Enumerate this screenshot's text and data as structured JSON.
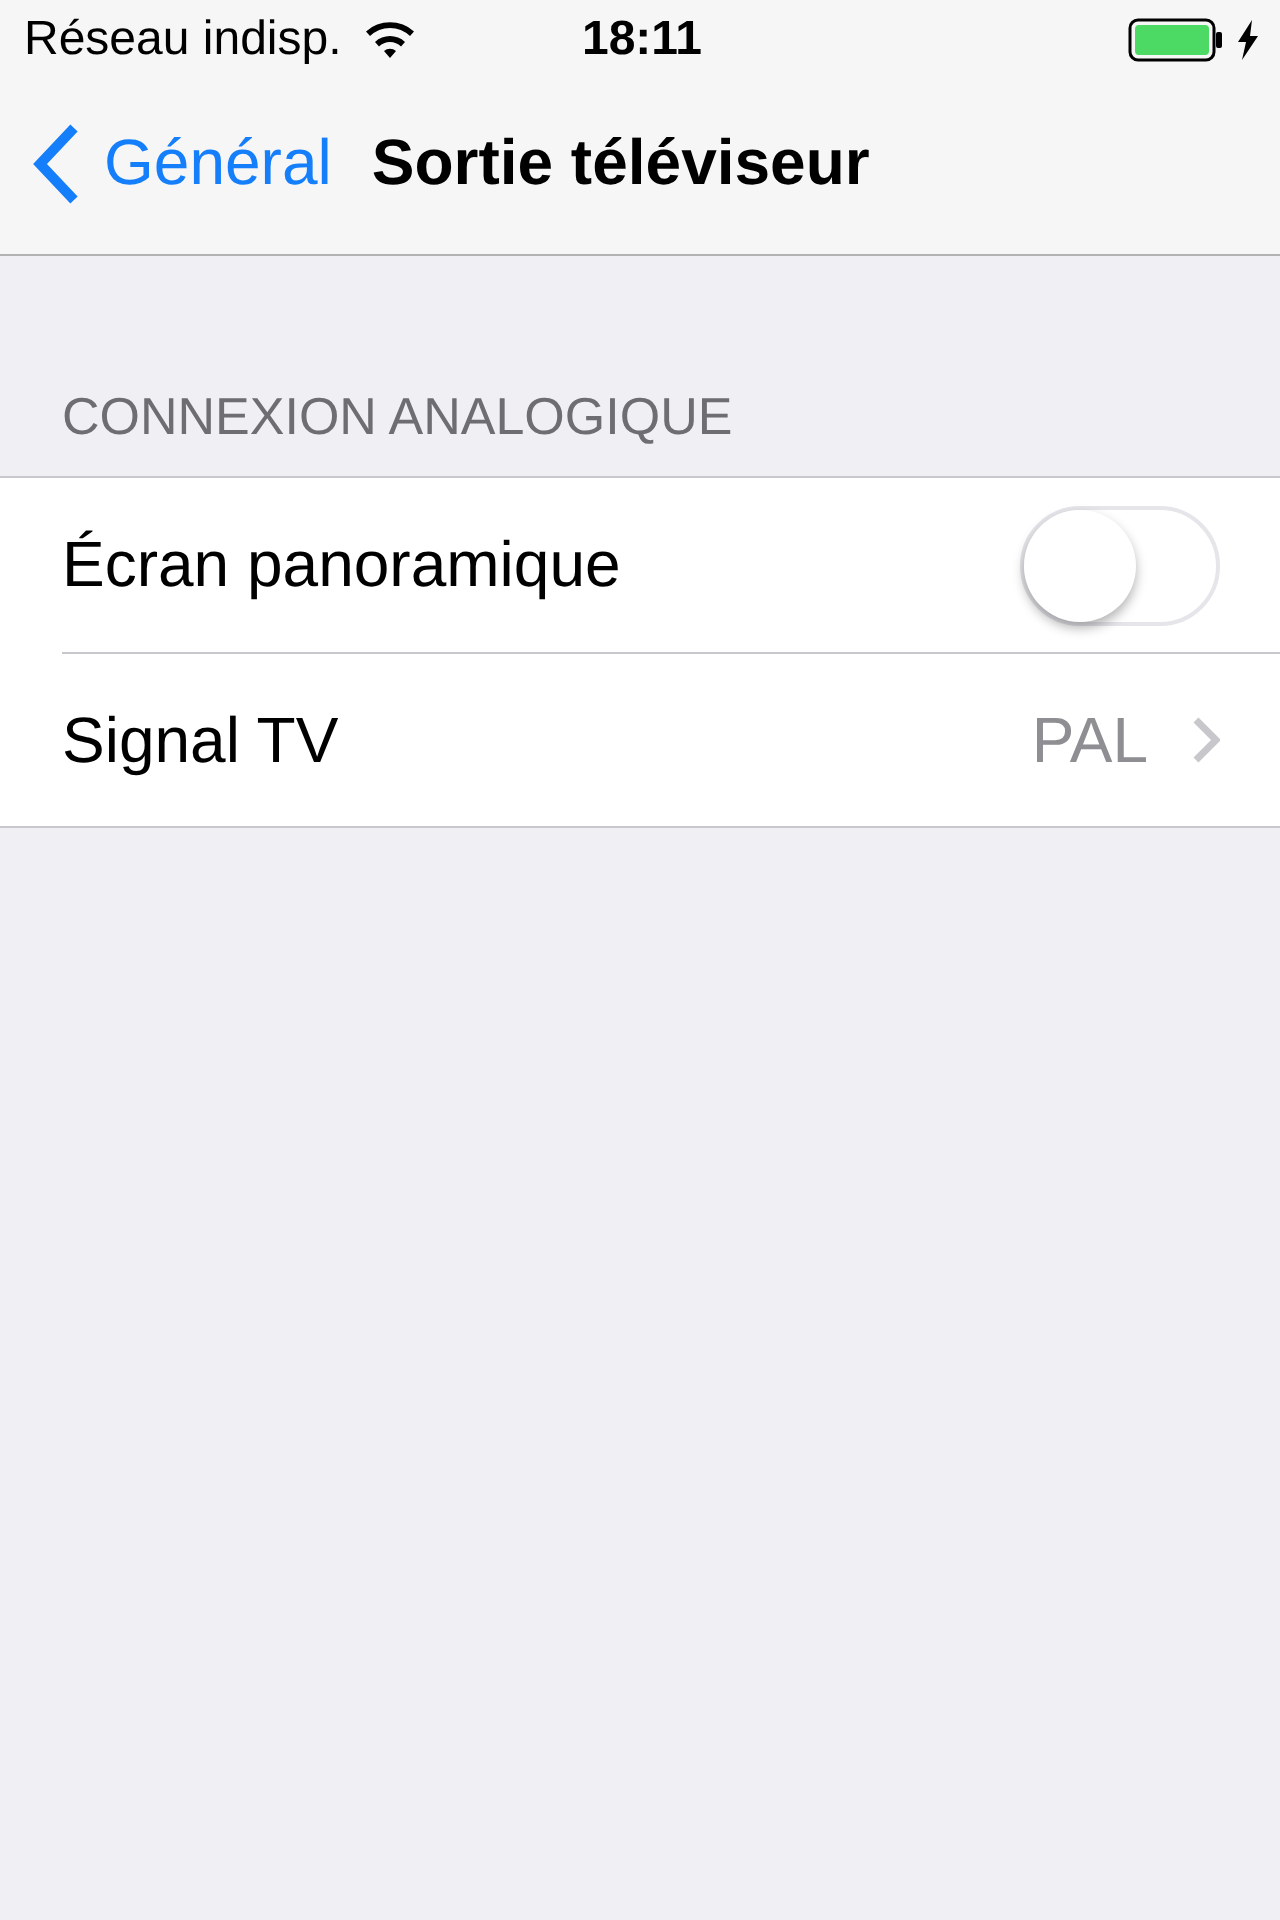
{
  "status_bar": {
    "carrier": "Réseau indisp.",
    "time": "18:11"
  },
  "nav_bar": {
    "back": "Général",
    "title": "Sortie téléviseur"
  },
  "section": {
    "header": "CONNEXION ANALOGIQUE",
    "rows": [
      {
        "kind": "toggle",
        "label": "Écran panoramique",
        "on": false
      },
      {
        "kind": "disclosure",
        "label": "Signal TV",
        "value": "PAL"
      }
    ]
  }
}
